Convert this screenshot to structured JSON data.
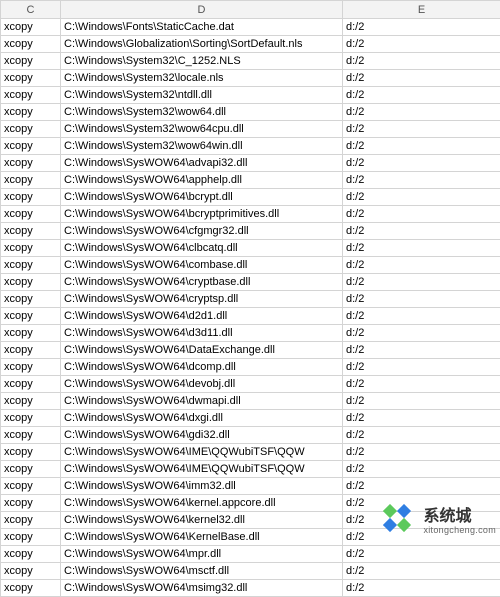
{
  "columns": {
    "c": "C",
    "d": "D",
    "e": "E"
  },
  "rows": [
    {
      "c": "xcopy",
      "d": "C:\\Windows\\Fonts\\StaticCache.dat",
      "e": "d:/2"
    },
    {
      "c": "xcopy",
      "d": "C:\\Windows\\Globalization\\Sorting\\SortDefault.nls",
      "e": "d:/2"
    },
    {
      "c": "xcopy",
      "d": "C:\\Windows\\System32\\C_1252.NLS",
      "e": "d:/2"
    },
    {
      "c": "xcopy",
      "d": "C:\\Windows\\System32\\locale.nls",
      "e": "d:/2"
    },
    {
      "c": "xcopy",
      "d": "C:\\Windows\\System32\\ntdll.dll",
      "e": "d:/2"
    },
    {
      "c": "xcopy",
      "d": "C:\\Windows\\System32\\wow64.dll",
      "e": "d:/2"
    },
    {
      "c": "xcopy",
      "d": "C:\\Windows\\System32\\wow64cpu.dll",
      "e": "d:/2"
    },
    {
      "c": "xcopy",
      "d": "C:\\Windows\\System32\\wow64win.dll",
      "e": "d:/2"
    },
    {
      "c": "xcopy",
      "d": "C:\\Windows\\SysWOW64\\advapi32.dll",
      "e": "d:/2"
    },
    {
      "c": "xcopy",
      "d": "C:\\Windows\\SysWOW64\\apphelp.dll",
      "e": "d:/2"
    },
    {
      "c": "xcopy",
      "d": "C:\\Windows\\SysWOW64\\bcrypt.dll",
      "e": "d:/2"
    },
    {
      "c": "xcopy",
      "d": "C:\\Windows\\SysWOW64\\bcryptprimitives.dll",
      "e": "d:/2"
    },
    {
      "c": "xcopy",
      "d": "C:\\Windows\\SysWOW64\\cfgmgr32.dll",
      "e": "d:/2"
    },
    {
      "c": "xcopy",
      "d": "C:\\Windows\\SysWOW64\\clbcatq.dll",
      "e": "d:/2"
    },
    {
      "c": "xcopy",
      "d": "C:\\Windows\\SysWOW64\\combase.dll",
      "e": "d:/2"
    },
    {
      "c": "xcopy",
      "d": "C:\\Windows\\SysWOW64\\cryptbase.dll",
      "e": "d:/2"
    },
    {
      "c": "xcopy",
      "d": "C:\\Windows\\SysWOW64\\cryptsp.dll",
      "e": "d:/2"
    },
    {
      "c": "xcopy",
      "d": "C:\\Windows\\SysWOW64\\d2d1.dll",
      "e": "d:/2"
    },
    {
      "c": "xcopy",
      "d": "C:\\Windows\\SysWOW64\\d3d11.dll",
      "e": "d:/2"
    },
    {
      "c": "xcopy",
      "d": "C:\\Windows\\SysWOW64\\DataExchange.dll",
      "e": "d:/2"
    },
    {
      "c": "xcopy",
      "d": "C:\\Windows\\SysWOW64\\dcomp.dll",
      "e": "d:/2"
    },
    {
      "c": "xcopy",
      "d": "C:\\Windows\\SysWOW64\\devobj.dll",
      "e": "d:/2"
    },
    {
      "c": "xcopy",
      "d": "C:\\Windows\\SysWOW64\\dwmapi.dll",
      "e": "d:/2"
    },
    {
      "c": "xcopy",
      "d": "C:\\Windows\\SysWOW64\\dxgi.dll",
      "e": "d:/2"
    },
    {
      "c": "xcopy",
      "d": "C:\\Windows\\SysWOW64\\gdi32.dll",
      "e": "d:/2"
    },
    {
      "c": "xcopy",
      "d": "C:\\Windows\\SysWOW64\\IME\\QQWubiTSF\\QQW",
      "e": "d:/2"
    },
    {
      "c": "xcopy",
      "d": "C:\\Windows\\SysWOW64\\IME\\QQWubiTSF\\QQW",
      "e": "d:/2"
    },
    {
      "c": "xcopy",
      "d": "C:\\Windows\\SysWOW64\\imm32.dll",
      "e": "d:/2"
    },
    {
      "c": "xcopy",
      "d": "C:\\Windows\\SysWOW64\\kernel.appcore.dll",
      "e": "d:/2"
    },
    {
      "c": "xcopy",
      "d": "C:\\Windows\\SysWOW64\\kernel32.dll",
      "e": "d:/2"
    },
    {
      "c": "xcopy",
      "d": "C:\\Windows\\SysWOW64\\KernelBase.dll",
      "e": "d:/2"
    },
    {
      "c": "xcopy",
      "d": "C:\\Windows\\SysWOW64\\mpr.dll",
      "e": "d:/2"
    },
    {
      "c": "xcopy",
      "d": "C:\\Windows\\SysWOW64\\msctf.dll",
      "e": "d:/2"
    },
    {
      "c": "xcopy",
      "d": "C:\\Windows\\SysWOW64\\msimg32.dll",
      "e": "d:/2"
    }
  ],
  "watermark": {
    "brand": "系统城",
    "sub": "xitongcheng.com"
  }
}
